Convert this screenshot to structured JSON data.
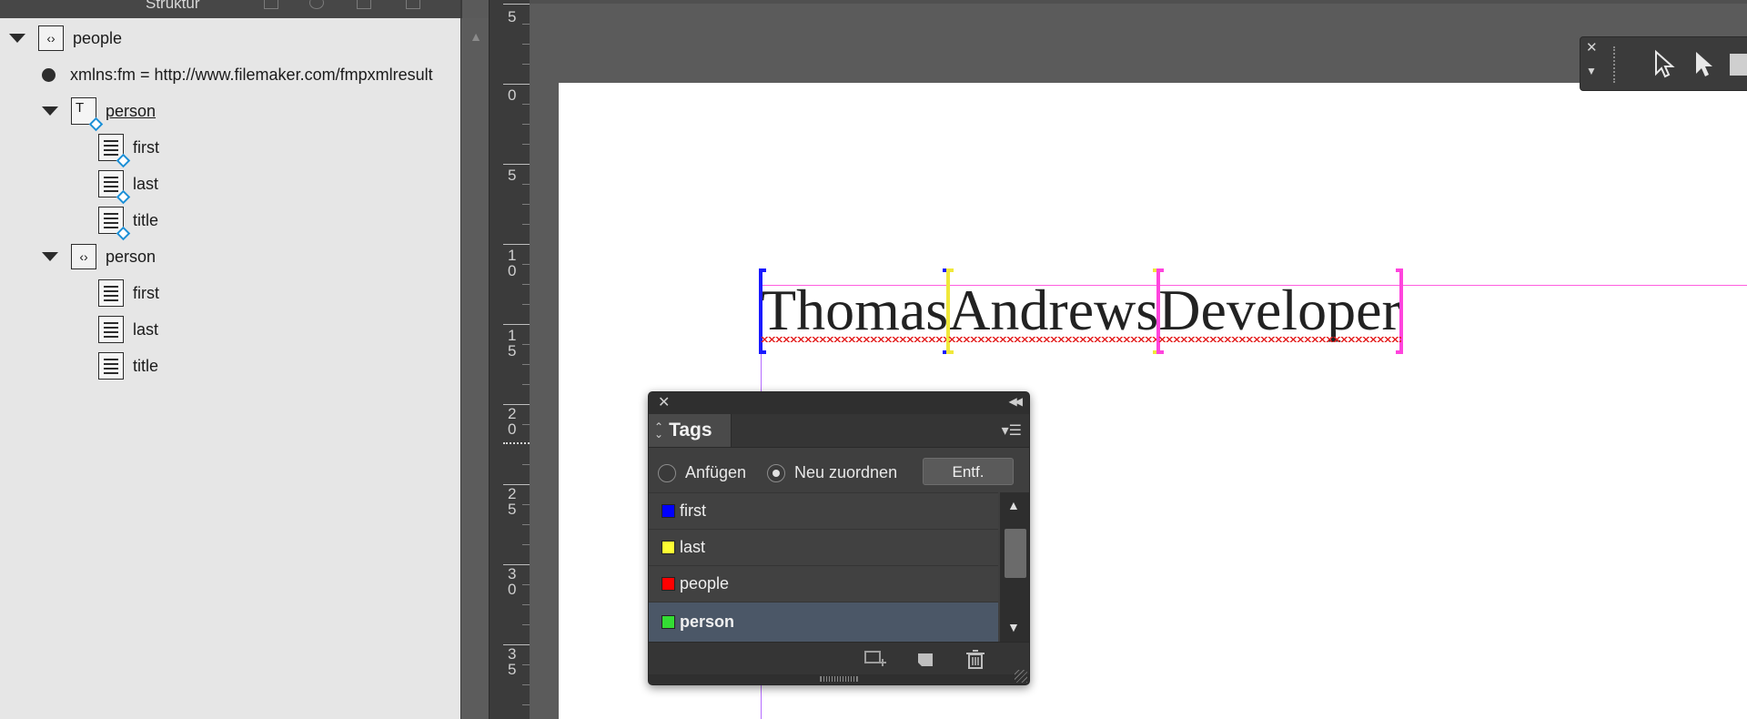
{
  "structure_panel": {
    "title": "Struktur",
    "tree": [
      {
        "label": "people",
        "kind": "element"
      },
      {
        "label": "xmlns:fm = http://www.filemaker.com/fmpxmlresult",
        "kind": "attribute"
      },
      {
        "label": "person",
        "kind": "story"
      },
      {
        "label": "first",
        "kind": "text"
      },
      {
        "label": "last",
        "kind": "text"
      },
      {
        "label": "title",
        "kind": "text"
      },
      {
        "label": "person",
        "kind": "element"
      },
      {
        "label": "first",
        "kind": "text"
      },
      {
        "label": "last",
        "kind": "text"
      },
      {
        "label": "title",
        "kind": "text"
      }
    ]
  },
  "ruler": {
    "labels": [
      "5",
      "0",
      "5",
      "1\n0",
      "1\n5",
      "2\n0",
      "2\n5",
      "3\n0",
      "3\n5"
    ]
  },
  "document": {
    "first": "Thomas",
    "last": "Andrews",
    "title": "Developer"
  },
  "tags_panel": {
    "tab_label": "Tags",
    "radio_append": "Anfügen",
    "radio_retag": "Neu zuordnen",
    "selected_mode": "Neu zuordnen",
    "remove_button": "Entf.",
    "tags": [
      {
        "name": "first",
        "color": "#0000ff"
      },
      {
        "name": "last",
        "color": "#ffff33"
      },
      {
        "name": "people",
        "color": "#ff0000"
      },
      {
        "name": "person",
        "color": "#33dd33"
      }
    ],
    "selected_tag": "person"
  },
  "colors": {
    "tag_first": "#1a1aff",
    "tag_last": "#f0e83a",
    "tag_title": "#ff44dd",
    "spellcheck": "#e42020"
  }
}
